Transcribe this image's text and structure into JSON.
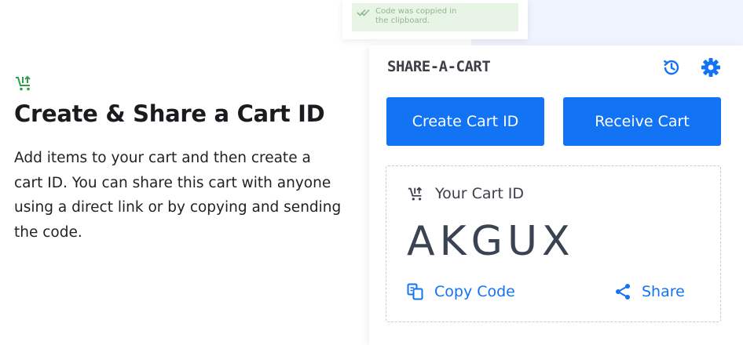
{
  "toast": {
    "message_line1": "Code was coppied in",
    "message_line2": "the clipboard."
  },
  "promo": {
    "title": "Create & Share a Cart ID",
    "body": "Add items to your cart and then create a cart ID. You can share this cart with anyone using a direct link or by copying and sending the code."
  },
  "panel": {
    "brand": "SHARE-A-CART",
    "create_label": "Create Cart ID",
    "receive_label": "Receive Cart",
    "cart_label": "Your Cart ID",
    "cart_id": "AKGUX",
    "copy_label": "Copy Code",
    "share_label": "Share"
  },
  "icons": {
    "promo": "cart-share-icon",
    "history": "history-icon",
    "settings": "gear-icon",
    "cart_label": "cart-share-icon",
    "copy": "copy-icon",
    "share": "share-icon",
    "toast": "double-check-icon"
  },
  "colors": {
    "accent": "#1273f5",
    "brand_green": "#2e9e4a",
    "toast_bg": "#e8f5e6",
    "text_dark": "#1b1b1f"
  }
}
